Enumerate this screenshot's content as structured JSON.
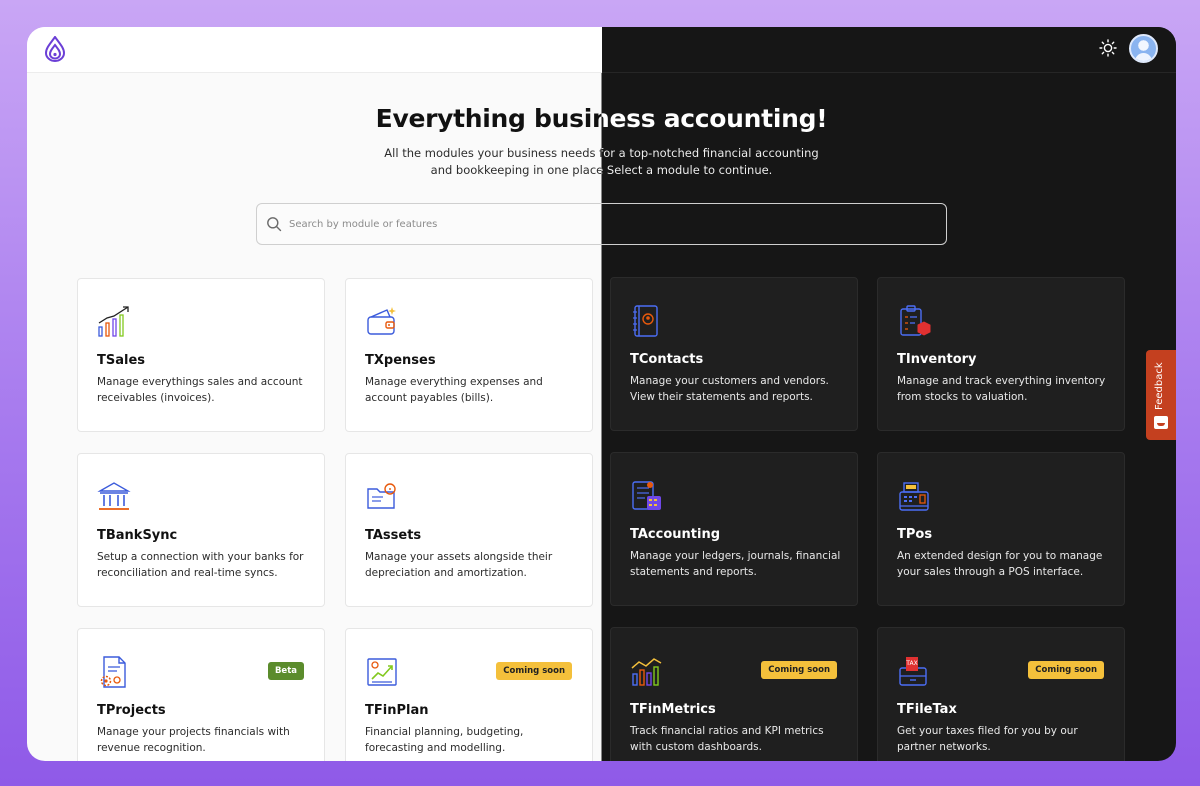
{
  "header": {
    "logo": "droplet-logo",
    "theme_toggle": "sun-icon",
    "avatar": "user-avatar"
  },
  "hero": {
    "title": "Everything business accounting!",
    "subtitle_line1": "All the modules your business needs for a top-notched financial accounting",
    "subtitle_line2": "and bookkeeping in one place Select a module to continue."
  },
  "search": {
    "placeholder": "Search by module or features",
    "value": ""
  },
  "modules": [
    {
      "title": "TSales",
      "desc": "Manage everythings sales and account receivables (invoices).",
      "badge": "",
      "icon": "sales-chart-icon"
    },
    {
      "title": "TXpenses",
      "desc": "Manage everything expenses and account payables (bills).",
      "badge": "",
      "icon": "wallet-icon"
    },
    {
      "title": "TContacts",
      "desc": "Manage your customers and vendors. View their statements and reports.",
      "badge": "",
      "icon": "contacts-book-icon"
    },
    {
      "title": "TInventory",
      "desc": "Manage and track everything inventory from stocks to valuation.",
      "badge": "",
      "icon": "inventory-clipboard-icon"
    },
    {
      "title": "TBankSync",
      "desc": "Setup a connection with your banks for reconciliation and real-time syncs.",
      "badge": "",
      "icon": "bank-icon"
    },
    {
      "title": "TAssets",
      "desc": "Manage your assets alongside their depreciation and amortization.",
      "badge": "",
      "icon": "assets-folder-icon"
    },
    {
      "title": "TAccounting",
      "desc": "Manage your ledgers, journals, financial statements and reports.",
      "badge": "",
      "icon": "accounting-ledger-icon"
    },
    {
      "title": "TPos",
      "desc": "An extended design for you to manage your sales through a POS interface.",
      "badge": "",
      "icon": "cash-register-icon"
    },
    {
      "title": "TProjects",
      "desc": "Manage your projects financials with revenue recognition.",
      "badge": "Beta",
      "icon": "project-document-icon"
    },
    {
      "title": "TFinPlan",
      "desc": "Financial planning, budgeting, forecasting and modelling.",
      "badge": "Coming soon",
      "icon": "finplan-chart-icon"
    },
    {
      "title": "TFinMetrics",
      "desc": "Track financial ratios and KPI metrics with custom dashboards.",
      "badge": "Coming soon",
      "icon": "finmetrics-icon"
    },
    {
      "title": "TFileTax",
      "desc": "Get your taxes filed for you by our partner networks.",
      "badge": "Coming soon",
      "icon": "tax-box-icon"
    }
  ],
  "feedback": {
    "label": "Feedback"
  },
  "colors": {
    "accent": "#6b3fd6",
    "badge_beta": "#5b8c2c",
    "badge_soon": "#f4c03b",
    "feedback": "#c4401f",
    "dark_bg": "#161616",
    "dark_card": "#1f1f1f"
  }
}
